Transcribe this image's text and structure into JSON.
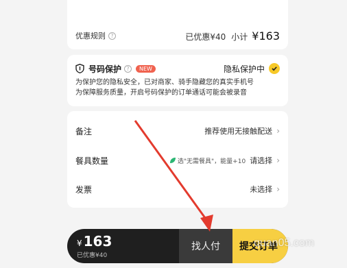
{
  "discount": {
    "label": "优惠规则",
    "help": "?",
    "saved": "已优惠¥40",
    "subtotal_label": "小计",
    "subtotal_value": "¥163"
  },
  "privacy": {
    "title": "号码保护",
    "help": "?",
    "badge": "NEW",
    "status": "隐私保护中",
    "line1": "为保护您的隐私安全，已对商家、骑手隐藏您的真实手机号",
    "line2": "为保障服务质量，开启号码保护的订单通话可能会被录音"
  },
  "options": {
    "remark": {
      "label": "备注",
      "value": "推荐使用无接触配送"
    },
    "tableware": {
      "label": "餐具数量",
      "note": "选\"无需餐具\"，能量+10",
      "value": "请选择"
    },
    "invoice": {
      "label": "发票",
      "value": "未选择"
    }
  },
  "bottom_bar": {
    "currency": "¥",
    "price": "163",
    "saved": "已优惠¥40",
    "find_pay": "找人付",
    "submit": "提交订单"
  },
  "watermark": "quan05.com",
  "colors": {
    "accent": "#f7cf42",
    "badge": "#f0624f",
    "leaf": "#2bb673",
    "annotation_arrow": "#e33b2e"
  },
  "icons": [
    "help-icon",
    "shield-icon",
    "check-icon",
    "chevron-right-icon",
    "leaf-icon"
  ]
}
